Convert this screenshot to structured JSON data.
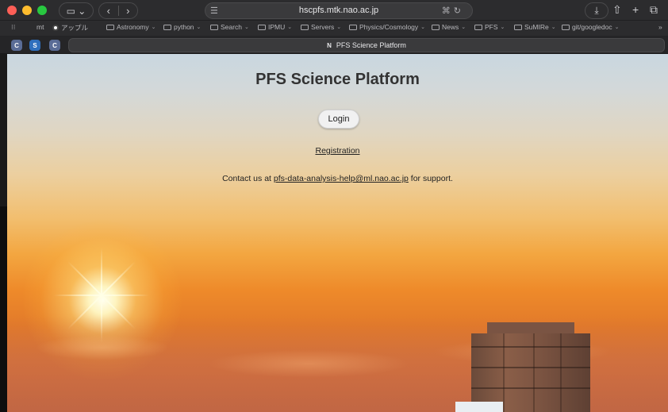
{
  "browser": {
    "url": "hscpfs.mtk.nao.ac.jp",
    "tab_title": "PFS Science Platform",
    "tab_favicon": "N",
    "pinned_tabs": [
      "C",
      "S",
      "C"
    ],
    "favorites": [
      {
        "label": "mt",
        "icon": "none"
      },
      {
        "label": "アップル",
        "icon": "apple-dot-icon"
      },
      {
        "label": "Astronomy",
        "icon": "folder-icon"
      },
      {
        "label": "python",
        "icon": "folder-icon"
      },
      {
        "label": "Search",
        "icon": "folder-icon"
      },
      {
        "label": "IPMU",
        "icon": "folder-icon"
      },
      {
        "label": "Servers",
        "icon": "folder-icon"
      },
      {
        "label": "Physics/Cosmology",
        "icon": "folder-icon"
      },
      {
        "label": "News",
        "icon": "folder-icon"
      },
      {
        "label": "PFS",
        "icon": "folder-icon"
      },
      {
        "label": "SuMIRe",
        "icon": "folder-icon"
      },
      {
        "label": "git/googledoc",
        "icon": "folder-icon"
      }
    ]
  },
  "page": {
    "title": "PFS Science Platform",
    "login_label": "Login",
    "registration_label": "Registration",
    "contact_prefix": "Contact us at ",
    "contact_email": "pfs-data-analysis-help@ml.nao.ac.jp",
    "contact_suffix": " for support."
  },
  "colors": {
    "close": "#fe5f57",
    "minimize": "#febc2e",
    "maximize": "#28c840",
    "chrome": "#2c2c2e"
  }
}
